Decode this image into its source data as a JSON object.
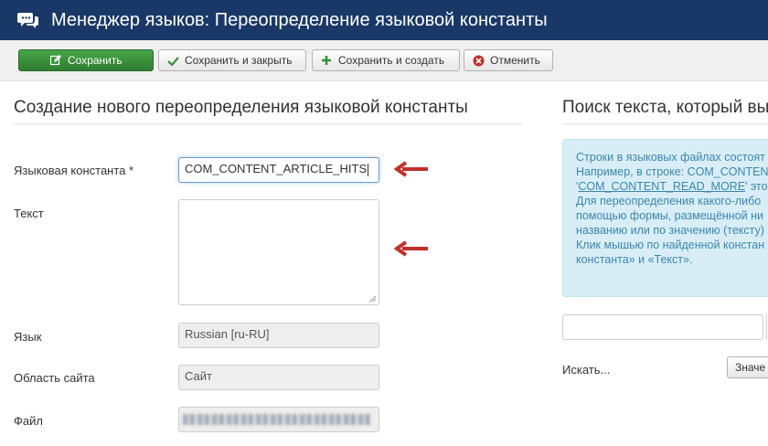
{
  "header": {
    "title": "Менеджер языков: Переопределение языковой константы",
    "icon": "comments-icon"
  },
  "toolbar": {
    "save_label": "Сохранить",
    "save_close_label": "Сохранить и закрыть",
    "save_new_label": "Сохранить и создать",
    "cancel_label": "Отменить"
  },
  "form": {
    "title": "Создание нового переопределения языковой константы",
    "constant_label": "Языковая константа *",
    "constant_value": "COM_CONTENT_ARTICLE_HITS",
    "text_label": "Текст",
    "text_value": "",
    "language_label": "Язык",
    "language_value": "Russian [ru-RU]",
    "site_label": "Область сайта",
    "site_value": "Сайт",
    "file_label": "Файл"
  },
  "search": {
    "title": "Поиск текста, который вы",
    "info_lines": [
      "Строки в языковых файлах состоят",
      "Например, в строке: COM_CONTENT",
      "'",
      "COM_CONTENT_READ_MORE",
      "' это",
      "Для переопределения какого-либо",
      "помощью формы, размещённой ни",
      "названию или по значению (тексту)",
      "Клик мышью по найденной констан",
      "константа» и «Текст»."
    ],
    "search_label": "Искать...",
    "value_button": "Значе"
  },
  "colors": {
    "header": "#1a3867",
    "save": "#3c9a3f",
    "arrow": "#c0302b",
    "info_bg": "#d9edf7",
    "info_text": "#3a87ad"
  }
}
